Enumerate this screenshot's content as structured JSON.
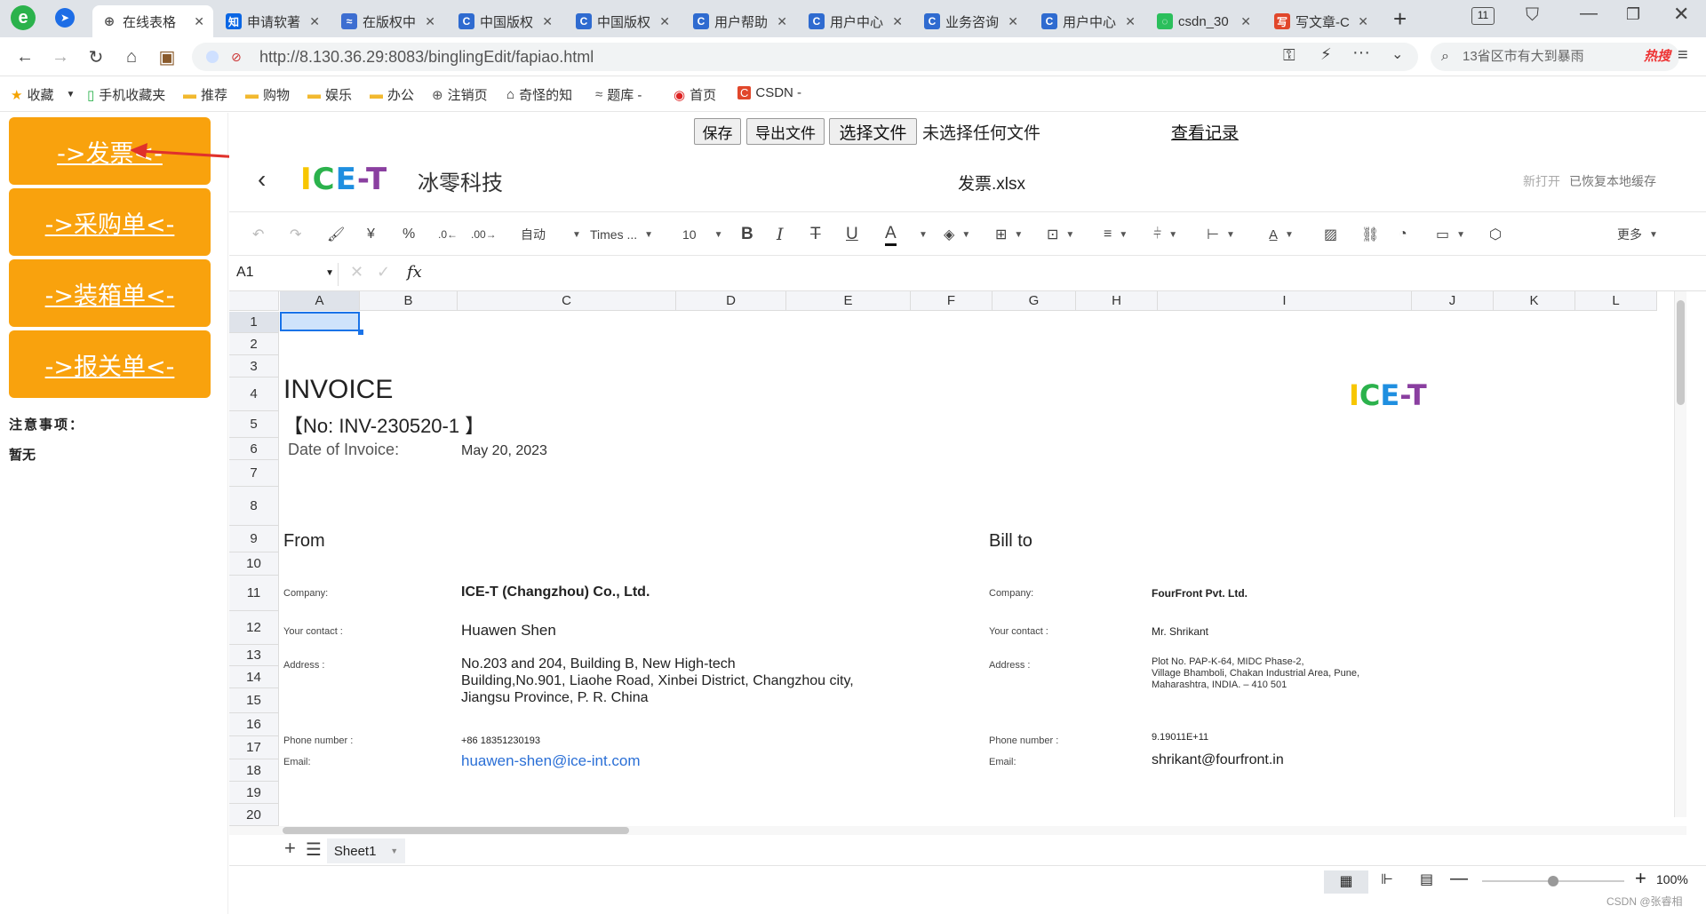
{
  "browser": {
    "tabs": [
      {
        "title": "在线表格",
        "fav": "globe-icon",
        "active": true
      },
      {
        "title": "申请软著",
        "fav": "zhihu-icon",
        "text": "知",
        "color": "#0a66e4"
      },
      {
        "title": "在版权中",
        "fav": "tech-icon",
        "text": "≈",
        "color": "#3d6ed1"
      },
      {
        "title": "中国版权",
        "fav": "c-icon",
        "text": "C",
        "color": "#2f6bd0"
      },
      {
        "title": "中国版权",
        "fav": "c-icon",
        "text": "C",
        "color": "#2f6bd0"
      },
      {
        "title": "用户帮助",
        "fav": "c-icon",
        "text": "C",
        "color": "#2f6bd0"
      },
      {
        "title": "用户中心",
        "fav": "c-icon",
        "text": "C",
        "color": "#2f6bd0"
      },
      {
        "title": "业务咨询",
        "fav": "c-icon",
        "text": "C",
        "color": "#2f6bd0"
      },
      {
        "title": "用户中心",
        "fav": "c-icon",
        "text": "C",
        "color": "#2f6bd0"
      },
      {
        "title": "csdn_30",
        "fav": "loading-icon",
        "text": "◌",
        "color": "#2bbf5c"
      },
      {
        "title": "写文章-C",
        "fav": "csdn-icon",
        "text": "写",
        "color": "#e1472b"
      }
    ],
    "tab_count": "11",
    "url": "http://8.130.36.29:8083/binglingEdit/fapiao.html",
    "search_placeholder": "13省区市有大到暴雨",
    "search_hot": "热搜",
    "bookmarks": [
      "收藏",
      "手机收藏夹",
      "推荐",
      "购物",
      "娱乐",
      "办公",
      "注销页",
      "奇怪的知",
      "题库 -",
      "首页",
      "CSDN -"
    ]
  },
  "left": {
    "nav": [
      "->发票<-",
      "->采购单<-",
      "->装箱单<-",
      "->报关单<-"
    ],
    "notes_title": "注意事项：",
    "notes_body": "暂无"
  },
  "actions": {
    "save": "保存",
    "export": "导出文件",
    "choose": "选择文件",
    "no_file": "未选择任何文件",
    "history": "查看记录"
  },
  "editor": {
    "brand_logo": "ICE-T",
    "brand_name": "冰零科技",
    "filename": "发票.xlsx",
    "status_new": "新打开",
    "status_restored": "已恢复本地缓存",
    "toolbar": {
      "format_auto": "自动",
      "font": "Times ...",
      "size": "10",
      "more": "更多"
    },
    "cell_ref": "A1",
    "fx": "fx",
    "columns": [
      "A",
      "B",
      "C",
      "D",
      "E",
      "F",
      "G",
      "H",
      "I",
      "J",
      "K",
      "L"
    ],
    "rows": [
      "1",
      "2",
      "3",
      "4",
      "5",
      "6",
      "7",
      "8",
      "9",
      "10",
      "11",
      "12",
      "13",
      "14",
      "15",
      "16",
      "17",
      "18",
      "19",
      "20"
    ],
    "sheet": {
      "title": "INVOICE",
      "number": "【No: INV-230520-1 】",
      "date_label": "Date of Invoice:",
      "date_value": "May 20, 2023",
      "from": "From",
      "bill_to": "Bill to",
      "company_label": "Company:",
      "contact_label": "Your contact :",
      "address_label": "Address :",
      "phone_label": "Phone number :",
      "email_label": "Email:",
      "from_company": "ICE-T (Changzhou) Co., Ltd.",
      "from_contact": "Huawen Shen",
      "from_address_1": "No.203 and 204, Building B, New High-tech",
      "from_address_2": "Building,No.901, Liaohe Road, Xinbei District, Changzhou city,",
      "from_address_3": "Jiangsu Province, P. R. China",
      "from_phone": "+86 18351230193",
      "from_email": "huawen-shen@ice-int.com",
      "to_company": "FourFront Pvt. Ltd.",
      "to_contact": "Mr. Shrikant",
      "to_address_1": "Plot No. PAP-K-64, MIDC Phase-2,",
      "to_address_2": "Village Bhamboli, Chakan Industrial Area, Pune,",
      "to_address_3": "Maharashtra, INDIA.   – 410 501",
      "to_phone": "9.19011E+11",
      "to_email": "shrikant@fourfront.in",
      "logo": "ICE-T"
    },
    "sheet_tab": "Sheet1",
    "zoom": "100%"
  },
  "watermark": "CSDN @张睿相",
  "colors": {
    "nav_orange": "#f9a20d",
    "logo_yellow": "#f7c600",
    "logo_green": "#2bb24c",
    "logo_blue": "#1f8fe0",
    "logo_purple": "#8a3fa0",
    "link_blue": "#2a6fd6",
    "arrow_red": "#e0312b"
  }
}
